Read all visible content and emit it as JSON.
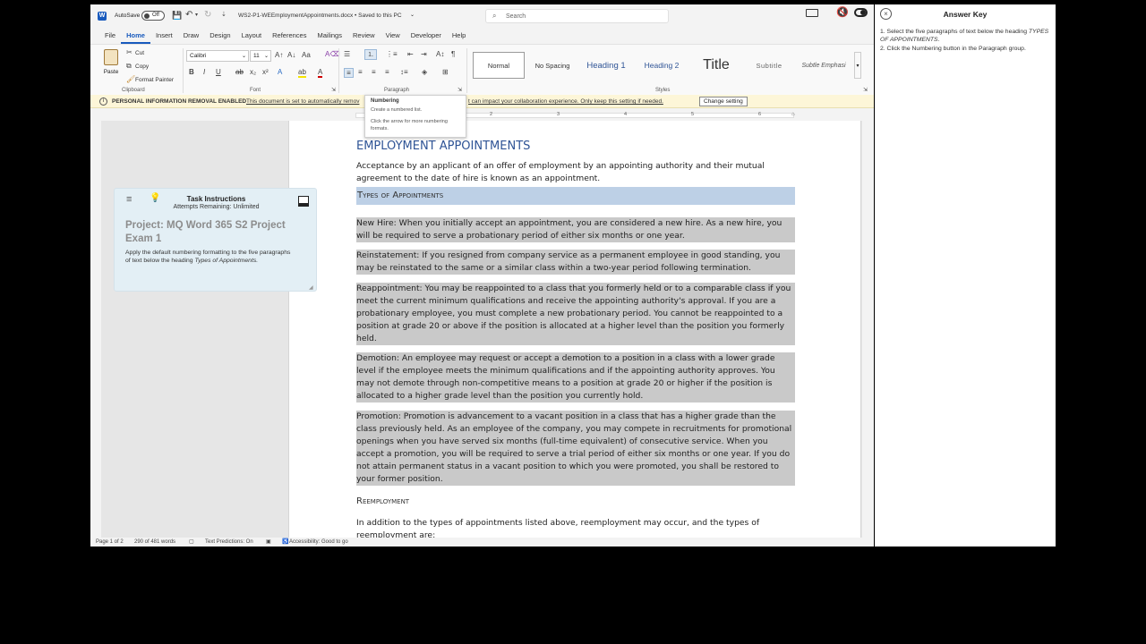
{
  "titlebar": {
    "autosave_label": "AutoSave",
    "autosave_state": "Off",
    "doc_title": "WS2-P1-WEEmploymentAppointments.docx • Saved to this PC",
    "search_placeholder": "Search"
  },
  "tabs": [
    "File",
    "Home",
    "Insert",
    "Draw",
    "Design",
    "Layout",
    "References",
    "Mailings",
    "Review",
    "View",
    "Developer",
    "Help"
  ],
  "ribbon": {
    "clipboard": {
      "paste": "Paste",
      "cut": "Cut",
      "copy": "Copy",
      "format_painter": "Format Painter",
      "label": "Clipboard"
    },
    "font": {
      "name": "Calibri",
      "size": "11",
      "label": "Font"
    },
    "paragraph": {
      "label": "Paragraph"
    },
    "styles": {
      "items": [
        "Normal",
        "No Spacing",
        "Heading 1",
        "Heading 2",
        "Title",
        "Subtitle",
        "Subtle Emphasi"
      ],
      "label": "Styles"
    }
  },
  "tooltip": {
    "title": "Numbering",
    "line1": "Create a numbered list.",
    "line2": "Click the arrow for more numbering formats."
  },
  "msgbar": {
    "title": "PERSONAL INFORMATION REMOVAL ENABLED",
    "text_left": "This document is set to automatically remov",
    "text_right": "t can impact your collaboration experience. Only keep this setting if needed.",
    "button": "Change setting"
  },
  "ruler": {
    "marks": [
      "1",
      "2",
      "3",
      "4",
      "5",
      "6"
    ]
  },
  "document": {
    "heading": "EMPLOYMENT APPOINTMENTS",
    "intro": "Acceptance by an applicant of an offer of employment by an appointing authority and their mutual agreement to the date of hire is known as an appointment.",
    "section_heading": "Types of Appointments",
    "paragraphs": [
      "New Hire: When you initially accept an appointment, you are considered a new hire. As a new hire, you will be required to serve a probationary period of either six months or one year.",
      "Reinstatement: If you resigned from company service as a permanent employee in good standing, you may be reinstated to the same or a similar class within a two-year period following termination.",
      "Reappointment: You may be reappointed to a class that you formerly held or to a comparable class if you meet the current minimum qualifications and receive the appointing authority's approval. If you are a probationary employee, you must complete a new probationary period. You cannot be reappointed to a position at grade 20 or above if the position is allocated at a higher level than the position you formerly held.",
      "Demotion: An employee may request or accept a demotion to a position in a class with a lower grade level if the employee meets the minimum qualifications and if the appointing authority approves. You may not demote through non-competitive means to a position at grade 20 or higher if the position is allocated to a higher grade level than the position you currently hold.",
      "Promotion: Promotion is advancement to a vacant position in a class that has a higher grade than the class previously held. As an employee of the company, you may compete in recruitments for promotional openings when you have served six months (full-time equivalent) of consecutive service. When you accept a promotion, you will be required to serve a trial period of either six months or one year. If you do not attain permanent status in a vacant position to which you were promoted, you shall be restored to your former position."
    ],
    "subheading": "Reemployment",
    "outro": "In addition to the types of appointments listed above, reemployment may occur, and the types of reemployment are:"
  },
  "task": {
    "title": "Task Instructions",
    "attempts": "Attempts Remaining: Unlimited",
    "project": "Project: MQ Word 365 S2 Project Exam 1",
    "instruction": "Apply the default numbering formatting to the five paragraphs of text below the heading ",
    "instruction_em": "Types of Appointments."
  },
  "statusbar": {
    "page": "Page 1 of 2",
    "words": "290 of 481 words",
    "predictions": "Text Predictions: On",
    "accessibility": "Accessibility: Good to go"
  },
  "answer": {
    "title": "Answer Key",
    "step1": "1. Select the five paragraphs of text below the heading ",
    "step1_em": "TYPES OF APPOINTMENTS.",
    "step2": "2. Click the Numbering button in the Paragraph group."
  }
}
